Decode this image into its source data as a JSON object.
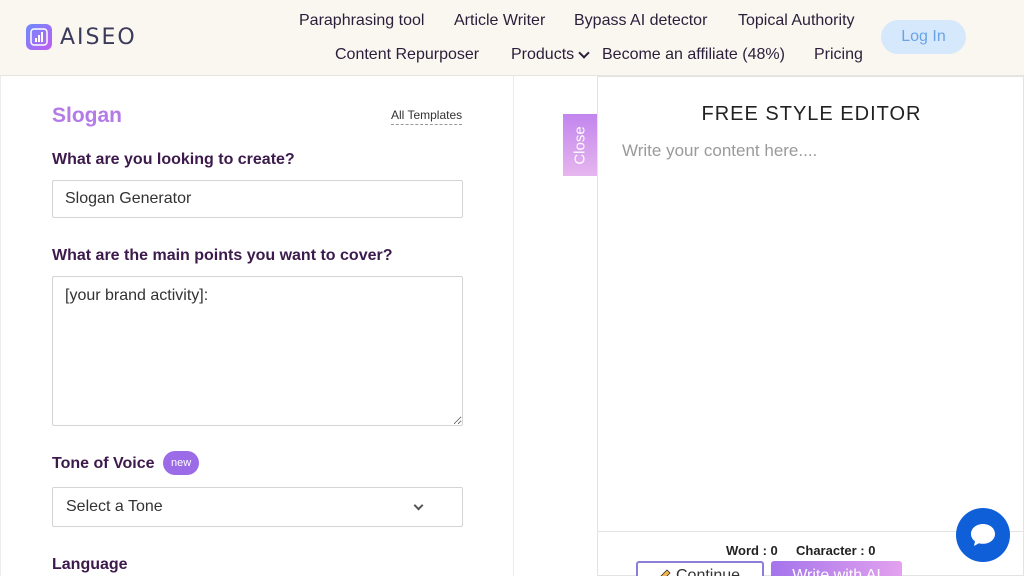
{
  "header": {
    "logo_text": "AISEO",
    "nav": {
      "paraphrasing": "Paraphrasing tool",
      "article_writer": "Article Writer",
      "bypass": "Bypass AI detector",
      "topical": "Topical Authority",
      "repurposer": "Content Repurposer",
      "products": "Products",
      "affiliate": "Become an affiliate (48%)",
      "pricing": "Pricing"
    },
    "login_label": "Log In"
  },
  "form": {
    "title": "Slogan",
    "all_templates": "All Templates",
    "create_label": "What are you looking to create?",
    "create_value": "Slogan Generator",
    "points_label": "What are the main points you want to cover?",
    "points_value": "[your brand activity]:",
    "tone_label": "Tone of Voice",
    "tone_badge": "new",
    "tone_placeholder": "Select a Tone",
    "language_label": "Language"
  },
  "editor": {
    "close_label": "Close",
    "title": "FREE STYLE EDITOR",
    "placeholder": "Write your content here....",
    "word_count": "Word : 0",
    "char_count": "Character : 0",
    "continue_label": "Continue",
    "write_ai_label": "Write with AI"
  },
  "colors": {
    "accent": "#b37be8",
    "label": "#3c1a4c",
    "chat": "#0f5fd8"
  }
}
